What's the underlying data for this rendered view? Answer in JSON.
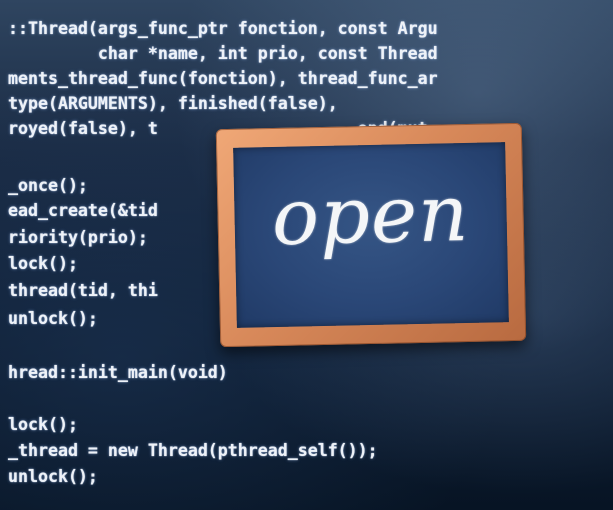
{
  "code_lines": [
    "::Thread(args_func_ptr fonction, const Argu",
    "         char *name, int prio, const Thread",
    "ments_thread_func(fonction), thread_func_ar",
    "type(ARGUMENTS), finished(false),",
    "royed(false), t                    ond(mut",
    "",
    "_once();",
    "ead_create(&tid                    this)",
    "riority(prio);",
    "lock();",
    "thread(tid, thi",
    "unlock();",
    "",
    "hread::init_main(void)",
    "",
    "lock();",
    "_thread = new Thread(pthread_self());",
    "unlock();"
  ],
  "sign": {
    "text": "open"
  }
}
